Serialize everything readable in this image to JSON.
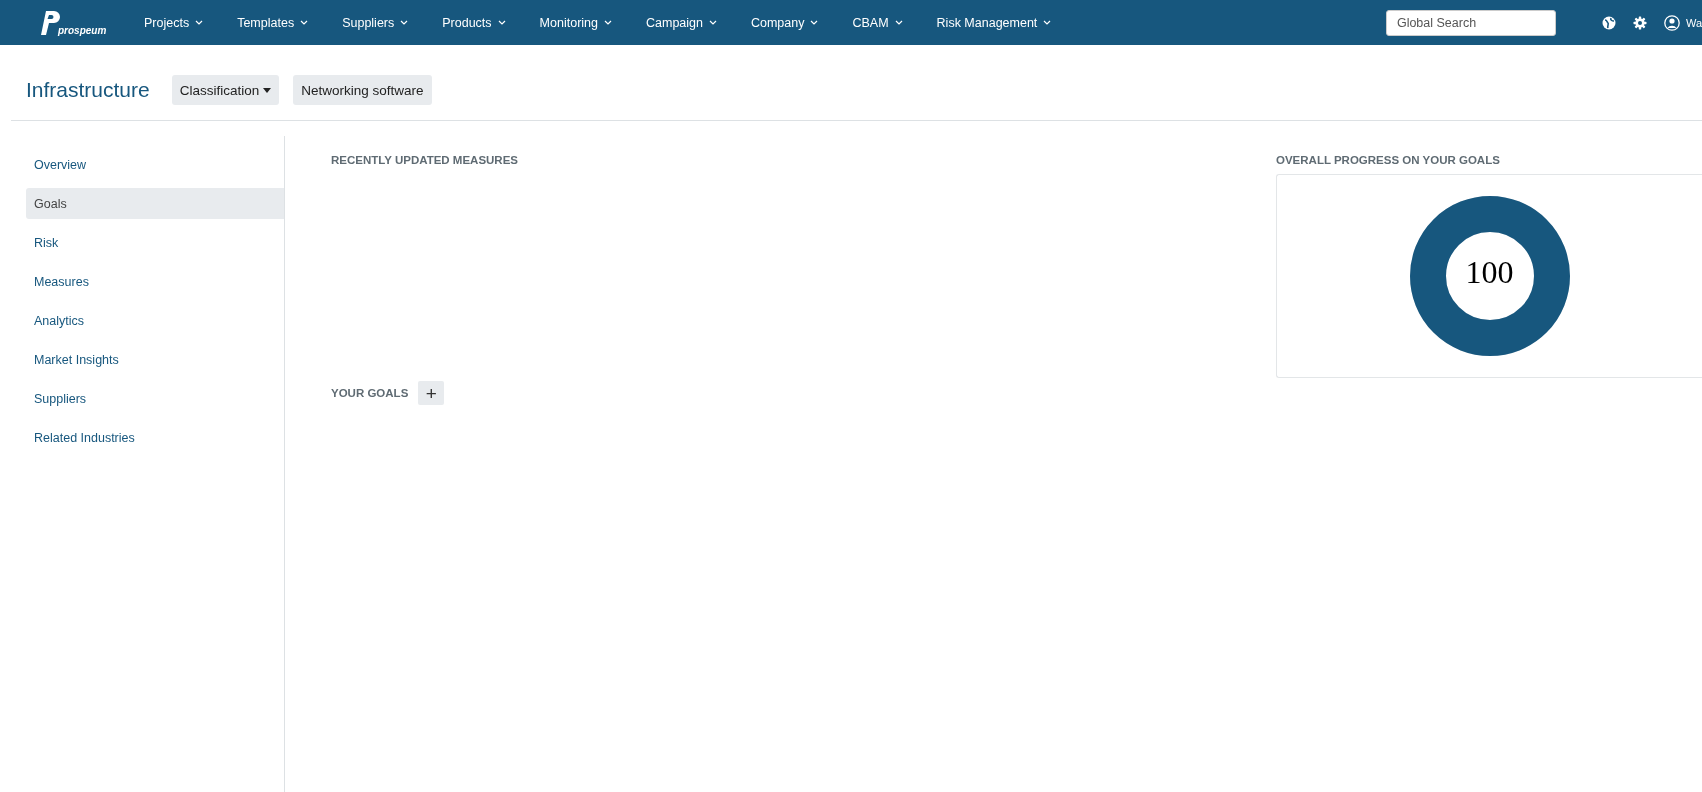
{
  "nav": {
    "logo": "prospeum",
    "items": [
      {
        "label": "Projects"
      },
      {
        "label": "Templates"
      },
      {
        "label": "Suppliers"
      },
      {
        "label": "Products"
      },
      {
        "label": "Monitoring"
      },
      {
        "label": "Campaign"
      },
      {
        "label": "Company"
      },
      {
        "label": "CBAM"
      },
      {
        "label": "Risk Management"
      }
    ],
    "search": {
      "placeholder": "Global Search"
    },
    "user": "Wa"
  },
  "header": {
    "title": "Infrastructure",
    "classification": "Classification",
    "tag": "Networking software"
  },
  "sidebar": {
    "items": [
      {
        "label": "Overview",
        "selected": false
      },
      {
        "label": "Goals",
        "selected": true
      },
      {
        "label": "Risk",
        "selected": false
      },
      {
        "label": "Measures",
        "selected": false
      },
      {
        "label": "Analytics",
        "selected": false
      },
      {
        "label": "Market Insights",
        "selected": false
      },
      {
        "label": "Suppliers",
        "selected": false
      },
      {
        "label": "Related Industries",
        "selected": false
      }
    ]
  },
  "main": {
    "recent_title": "RECENTLY UPDATED MEASURES",
    "goals_title": "YOUR GOALS",
    "add_label": "+"
  },
  "progress": {
    "title": "OVERALL PROGRESS ON YOUR GOALS",
    "value": "100",
    "level": 1
  }
}
